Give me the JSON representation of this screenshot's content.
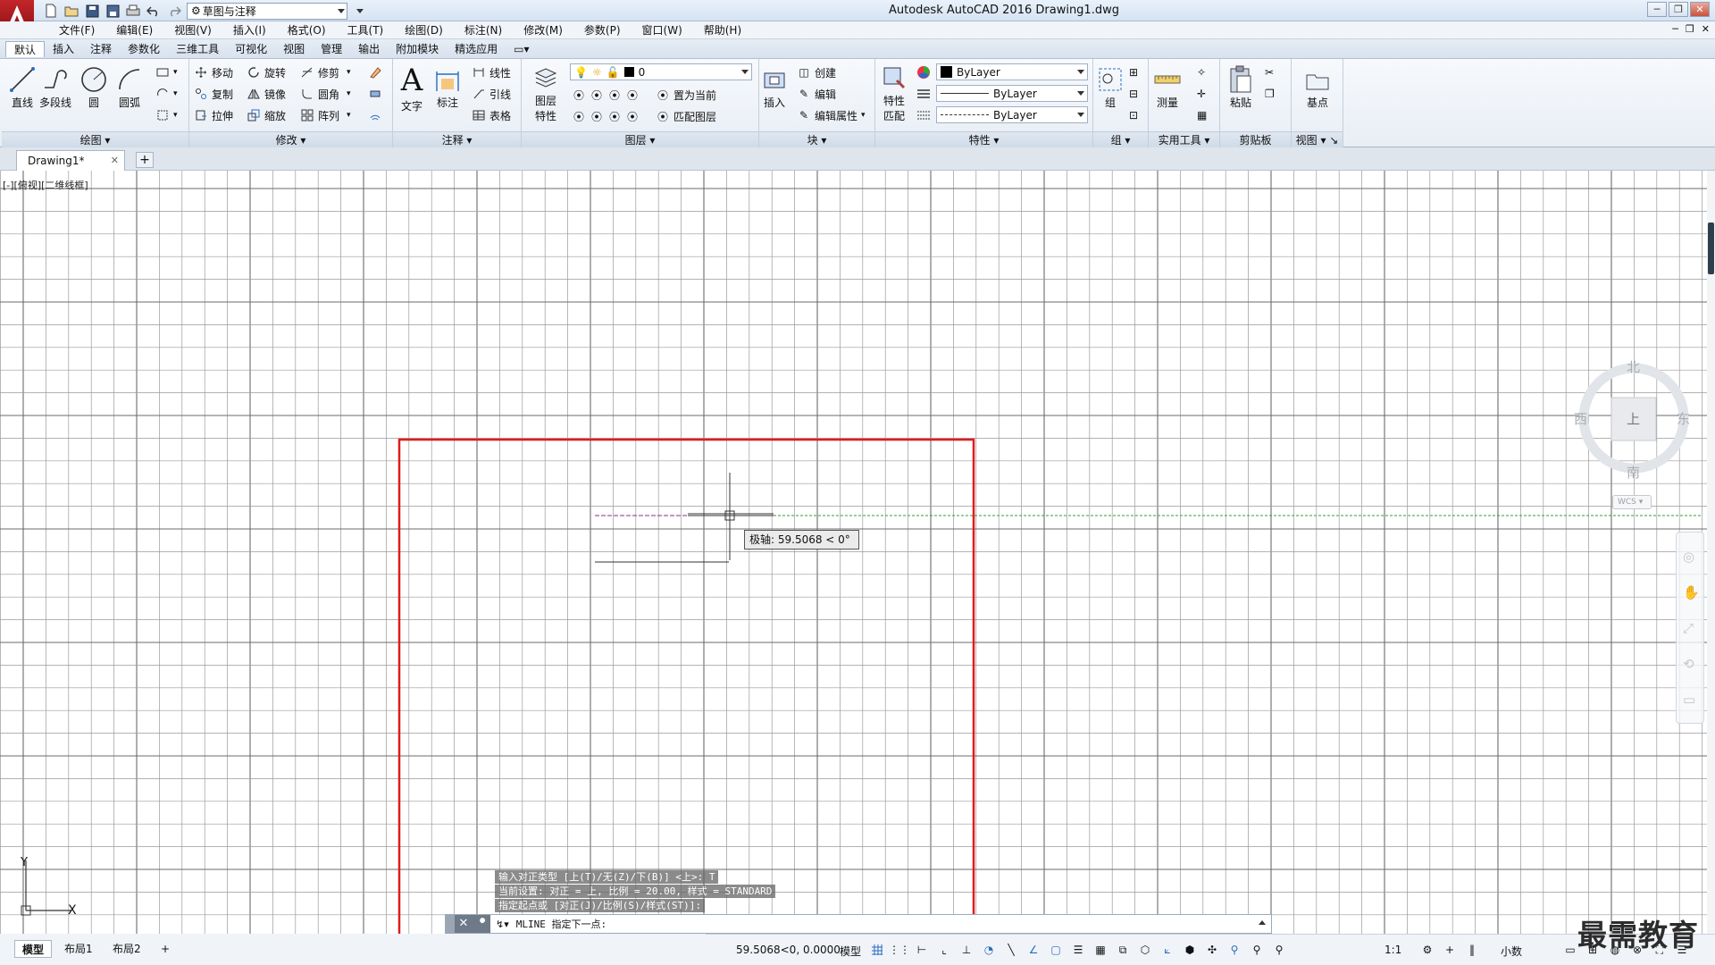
{
  "title_bar": {
    "title": "Autodesk AutoCAD 2016    Drawing1.dwg",
    "workspace": "草图与注释"
  },
  "menu": {
    "items": [
      "文件(F)",
      "编辑(E)",
      "视图(V)",
      "插入(I)",
      "格式(O)",
      "工具(T)",
      "绘图(D)",
      "标注(N)",
      "修改(M)",
      "参数(P)",
      "窗口(W)",
      "帮助(H)"
    ]
  },
  "ribbon_tabs": [
    "默认",
    "插入",
    "注释",
    "参数化",
    "三维工具",
    "可视化",
    "视图",
    "管理",
    "输出",
    "附加模块",
    "精选应用"
  ],
  "ribbon": {
    "draw": {
      "title": "绘图",
      "line": "直线",
      "polyline": "多段线",
      "circle": "圆",
      "arc": "圆弧"
    },
    "modify": {
      "title": "修改",
      "move": "移动",
      "rotate": "旋转",
      "trim": "修剪",
      "copy": "复制",
      "mirror": "镜像",
      "fillet": "圆角",
      "stretch": "拉伸",
      "scale": "缩放",
      "array": "阵列"
    },
    "annotation": {
      "title": "注释",
      "text": "文字",
      "dimension": "标注",
      "linear": "线性",
      "leader": "引线",
      "table": "表格"
    },
    "layers": {
      "title": "图层",
      "properties_l1": "图层",
      "properties_l2": "特性",
      "current_layer": "0",
      "make_current": "置为当前",
      "match_layer": "匹配图层"
    },
    "block": {
      "title": "块",
      "insert": "插入",
      "create": "创建",
      "edit": "编辑",
      "edit_attributes": "编辑属性"
    },
    "properties": {
      "title": "特性",
      "match_l1": "特性",
      "match_l2": "匹配",
      "color": "ByLayer",
      "linetype": "ByLayer",
      "lineweight": "ByLayer"
    },
    "groups": {
      "title": "组",
      "group": "组"
    },
    "utilities": {
      "title": "实用工具",
      "measure": "测量"
    },
    "clipboard": {
      "title": "剪贴板",
      "paste": "粘贴"
    },
    "view": {
      "title": "视图",
      "base": "基点"
    }
  },
  "file_tab": {
    "name": "Drawing1*"
  },
  "viewport": {
    "label": "[-][俯视][二维线框]",
    "tooltip": "极轴: 59.5068 < 0°"
  },
  "viewcube": {
    "north": "北",
    "south": "南",
    "east": "东",
    "west": "西",
    "face": "上",
    "wcs": "WCS"
  },
  "ucs": {
    "x": "X",
    "y": "Y"
  },
  "command": {
    "history": [
      "输入对正类型 [上(T)/无(Z)/下(B)] <上>: T",
      "当前设置: 对正 = 上, 比例 = 20.00, 样式 = STANDARD",
      "指定起点或 [对正(J)/比例(S)/样式(ST)]:"
    ],
    "prompt": "MLINE 指定下一点:"
  },
  "layout_tabs": [
    "模型",
    "布局1",
    "布局2"
  ],
  "status": {
    "coords": "59.5068<0, 0.0000",
    "space": "模型",
    "scale": "1:1",
    "units": "小数"
  },
  "watermark": "最需教育",
  "colors": {
    "highlight_box": "#e21b1b",
    "tracking_line": "#3a9b3a",
    "preview_line": "#8b2f8b",
    "logo": "#b5161c"
  }
}
